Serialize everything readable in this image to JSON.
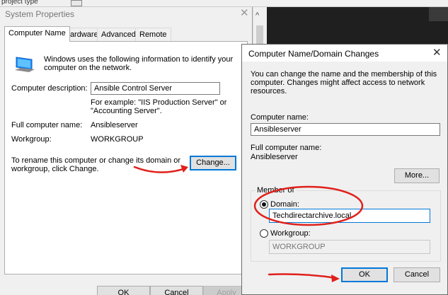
{
  "background": {
    "top_text_fragment": "project type"
  },
  "system_properties": {
    "title": "System Properties",
    "close_glyph": "✕",
    "tabs": [
      {
        "label": "Computer Name"
      },
      {
        "label": "Hardware"
      },
      {
        "label": "Advanced"
      },
      {
        "label": "Remote"
      }
    ],
    "active_tab": "Computer Name",
    "intro_text": "Windows uses the following information to identify your computer on the network.",
    "description_label": "Computer description:",
    "description_value": "Ansible Control Server",
    "example_text": "For example: \"IIS Production Server\" or \"Accounting Server\".",
    "full_name_label": "Full computer name:",
    "full_name_value": "Ansibleserver",
    "workgroup_label": "Workgroup:",
    "workgroup_value": "WORKGROUP",
    "rename_text": "To rename this computer or change its domain or workgroup, click Change.",
    "change_button": "Change...",
    "ok_button": "OK",
    "cancel_button": "Cancel",
    "apply_button": "Apply"
  },
  "domain_dialog": {
    "title": "Computer Name/Domain Changes",
    "close_glyph": "✕",
    "info_text": "You can change the name and the membership of this computer. Changes might affect access to network resources.",
    "computer_name_label": "Computer name:",
    "computer_name_value": "Ansibleserver",
    "full_name_label": "Full computer name:",
    "full_name_value": "Ansibleserver",
    "more_button": "More...",
    "member_of_label": "Member of",
    "domain_label": "Domain:",
    "domain_value": "Techdirectarchive.local",
    "domain_selected": true,
    "workgroup_label": "Workgroup:",
    "workgroup_value": "WORKGROUP",
    "ok_button": "OK",
    "cancel_button": "Cancel"
  },
  "colors": {
    "annotation_red": "#e0201b",
    "focus_blue": "#0078d7",
    "dialog_bg": "#f0f0f0"
  },
  "icons": {
    "computer": "computer-monitor-icon",
    "scroll_up": "chevron-up-icon"
  }
}
